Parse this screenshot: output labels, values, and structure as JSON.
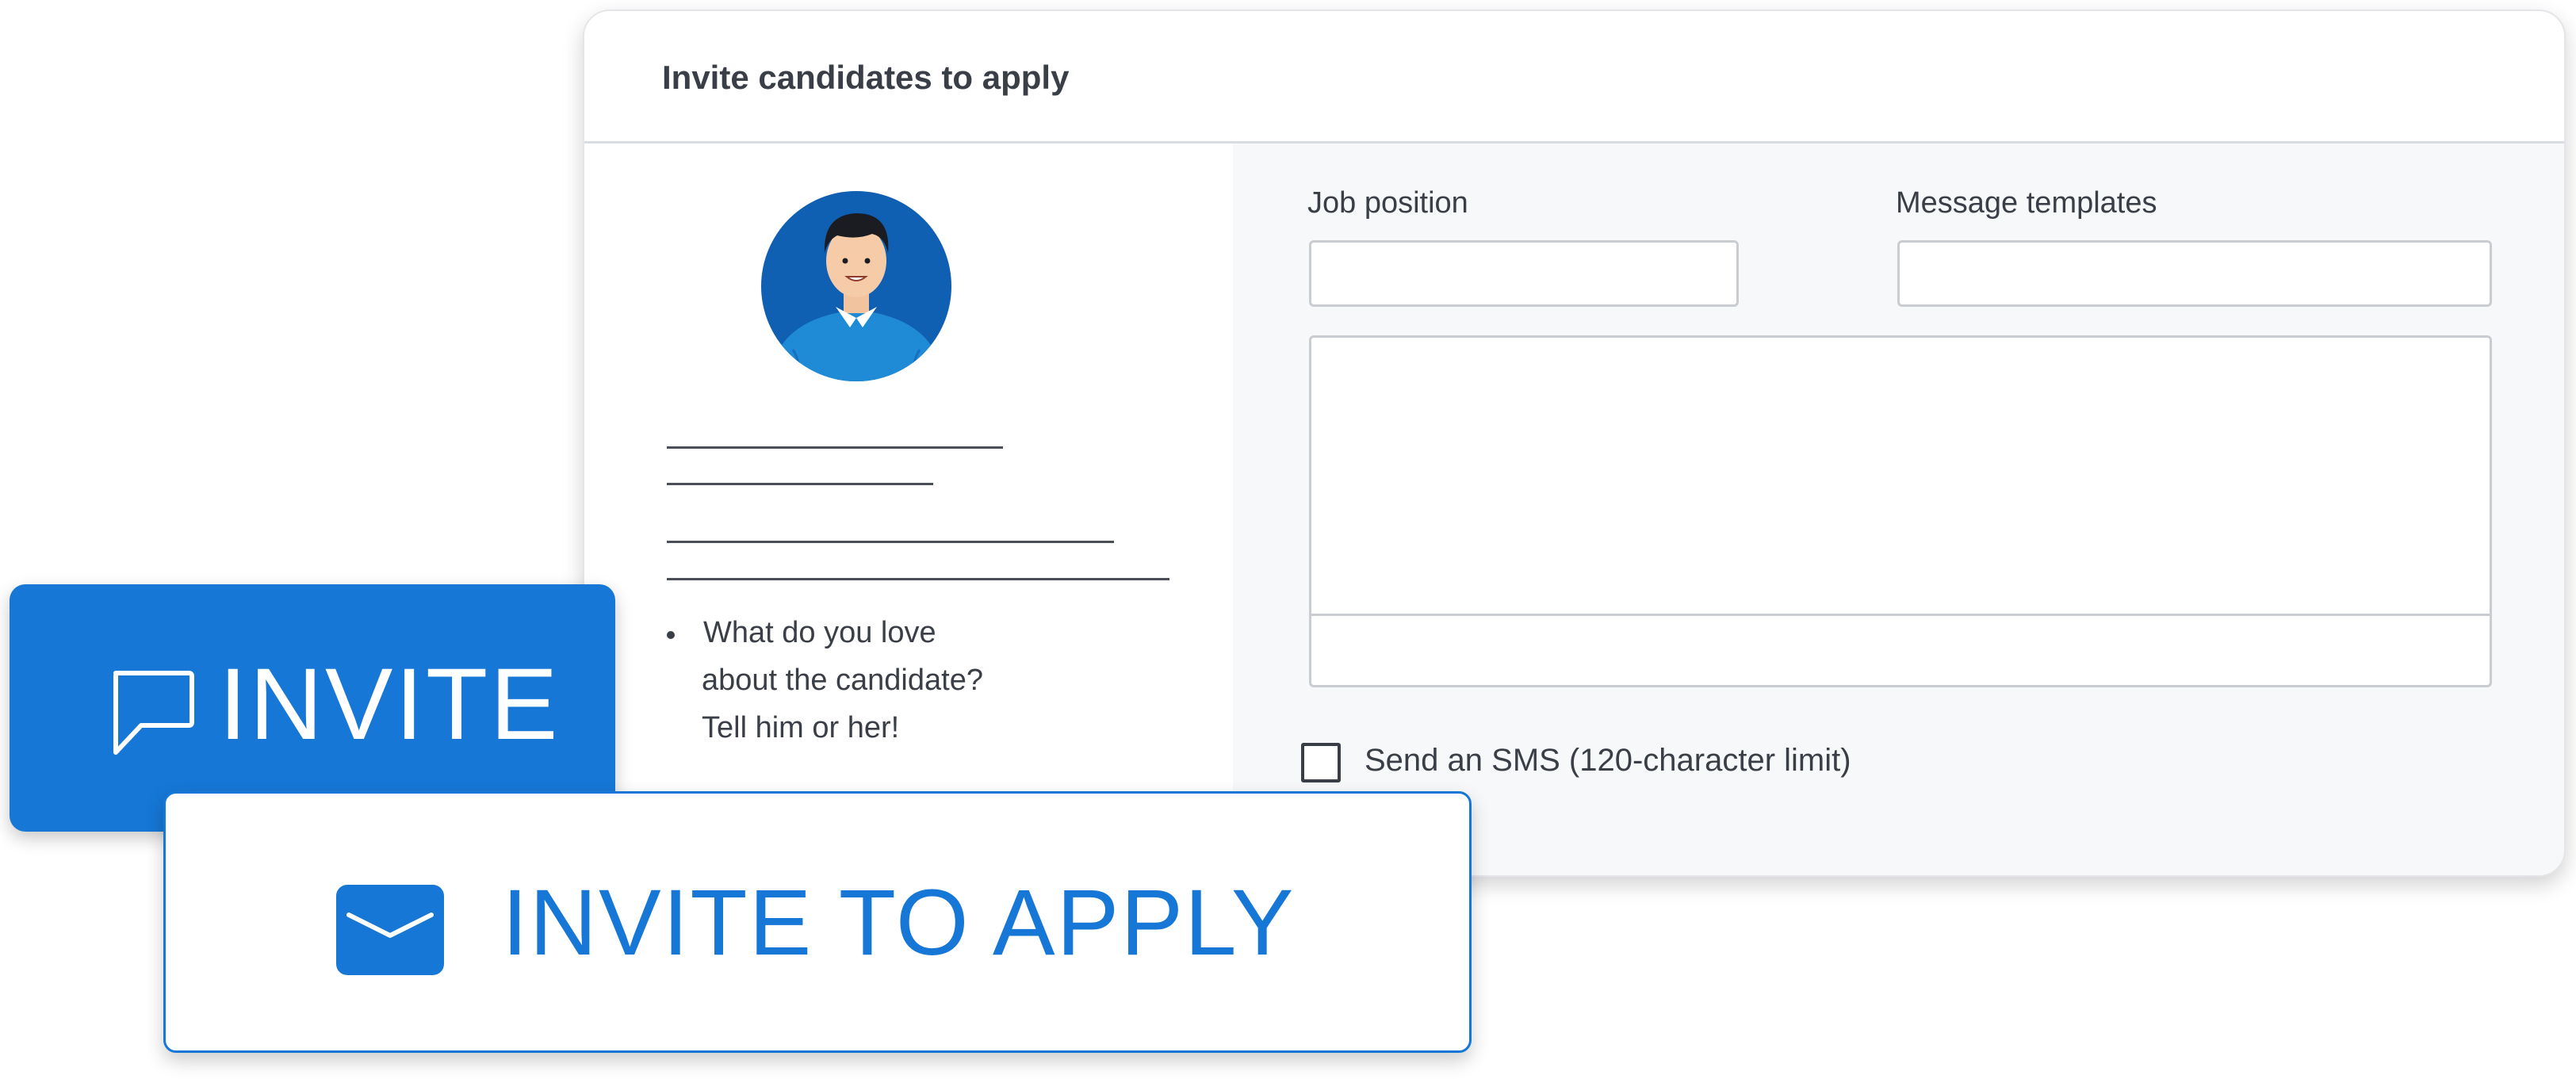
{
  "card": {
    "title": "Invite candidates to apply",
    "note_lines": [
      "What do you love",
      "about the candidate?",
      "Tell him or her!"
    ],
    "job_position": {
      "label": "Job position",
      "value": ""
    },
    "message_templates": {
      "label": "Message templates",
      "value": ""
    },
    "message": {
      "value": ""
    },
    "sms": {
      "label": "Send an SMS (120-character limit)",
      "checked": false
    }
  },
  "buttons": {
    "invite_label": "INVITE",
    "invite_to_apply_label": "INVITE TO APPLY"
  },
  "icons": {
    "invite": "chat-bubble-icon",
    "invite_to_apply": "envelope-icon"
  },
  "colors": {
    "accent": "#1677d6",
    "text": "#3a3f47",
    "pane_background": "#f7f8fa"
  }
}
